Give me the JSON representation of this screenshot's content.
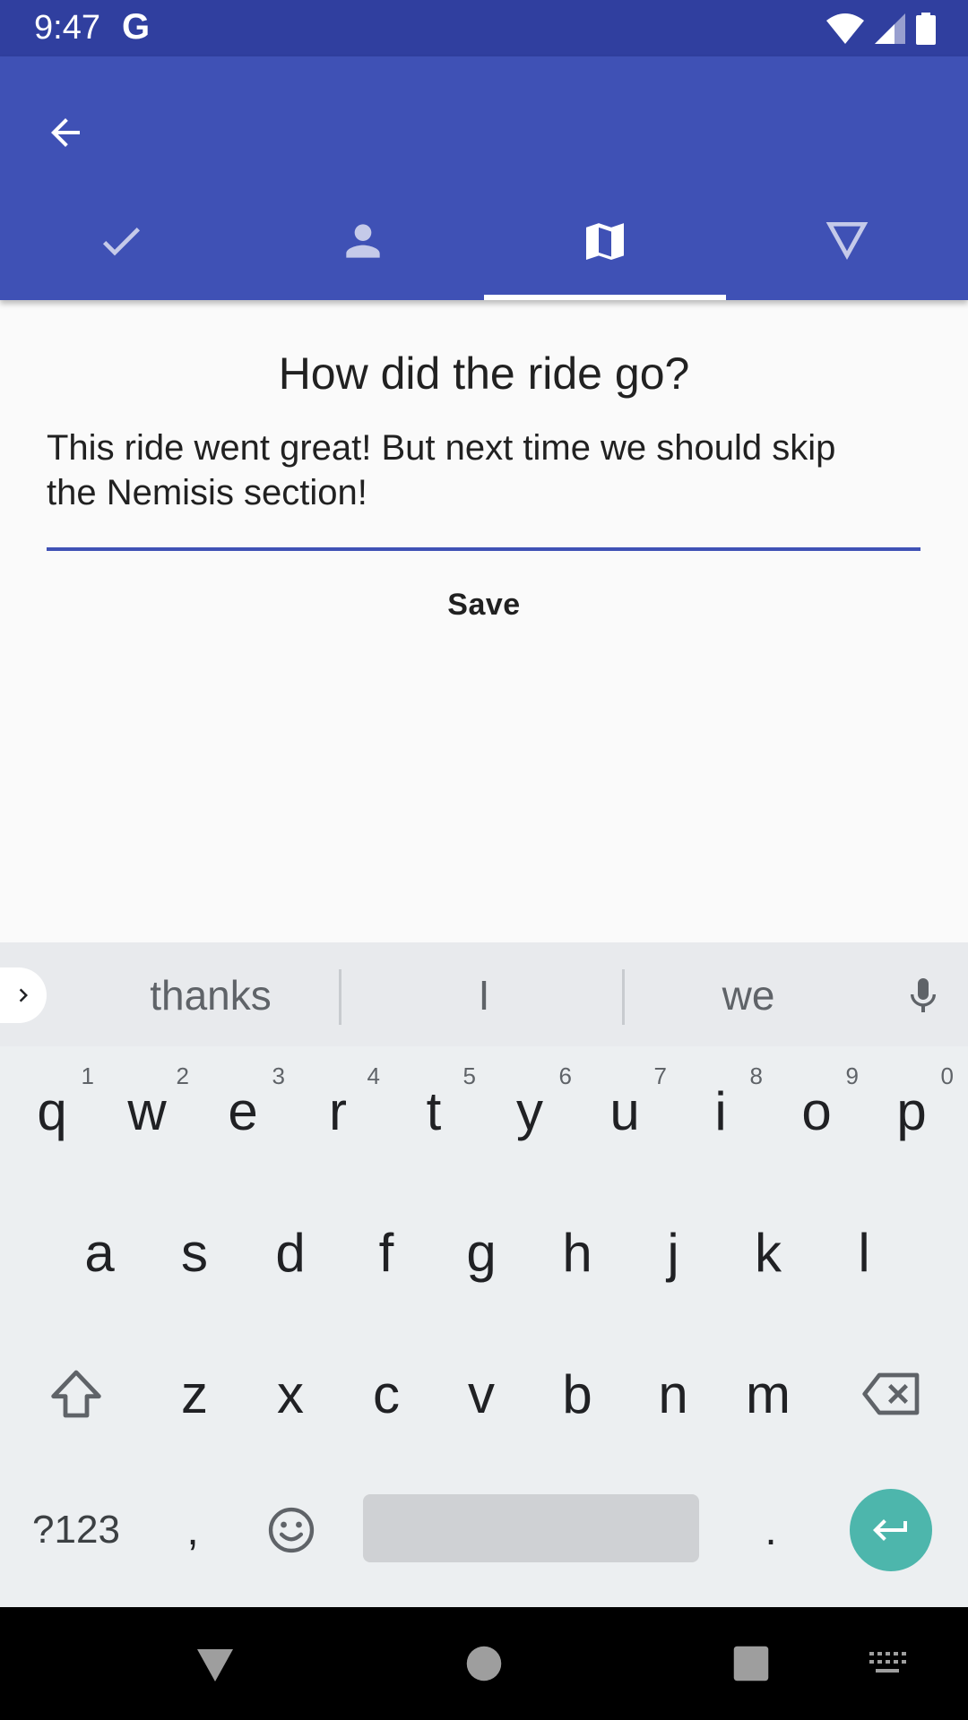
{
  "status_bar": {
    "time": "9:47",
    "provider_icon": "G"
  },
  "app_bar": {
    "back_icon": "arrow-back-icon",
    "tabs": [
      {
        "icon": "check-icon"
      },
      {
        "icon": "person-icon"
      },
      {
        "icon": "map-icon"
      },
      {
        "icon": "triangle-down-icon"
      }
    ],
    "active_tab": 2
  },
  "content": {
    "question": "How did the ride go?",
    "answer_value": "This ride went great! But next time we should skip\nthe Nemisis section!",
    "save_label": "Save"
  },
  "keyboard": {
    "suggestions": [
      "thanks",
      "I",
      "we"
    ],
    "row1": [
      {
        "key": "q",
        "hint": "1"
      },
      {
        "key": "w",
        "hint": "2"
      },
      {
        "key": "e",
        "hint": "3"
      },
      {
        "key": "r",
        "hint": "4"
      },
      {
        "key": "t",
        "hint": "5"
      },
      {
        "key": "y",
        "hint": "6"
      },
      {
        "key": "u",
        "hint": "7"
      },
      {
        "key": "i",
        "hint": "8"
      },
      {
        "key": "o",
        "hint": "9"
      },
      {
        "key": "p",
        "hint": "0"
      }
    ],
    "row2": [
      "a",
      "s",
      "d",
      "f",
      "g",
      "h",
      "j",
      "k",
      "l"
    ],
    "row3": [
      "z",
      "x",
      "c",
      "v",
      "b",
      "n",
      "m"
    ],
    "symbols_label": "?123",
    "comma": ",",
    "period": "."
  },
  "colors": {
    "primary": "#3f51b5",
    "primary_dark": "#303f9f",
    "enter_key": "#4db6ac"
  }
}
